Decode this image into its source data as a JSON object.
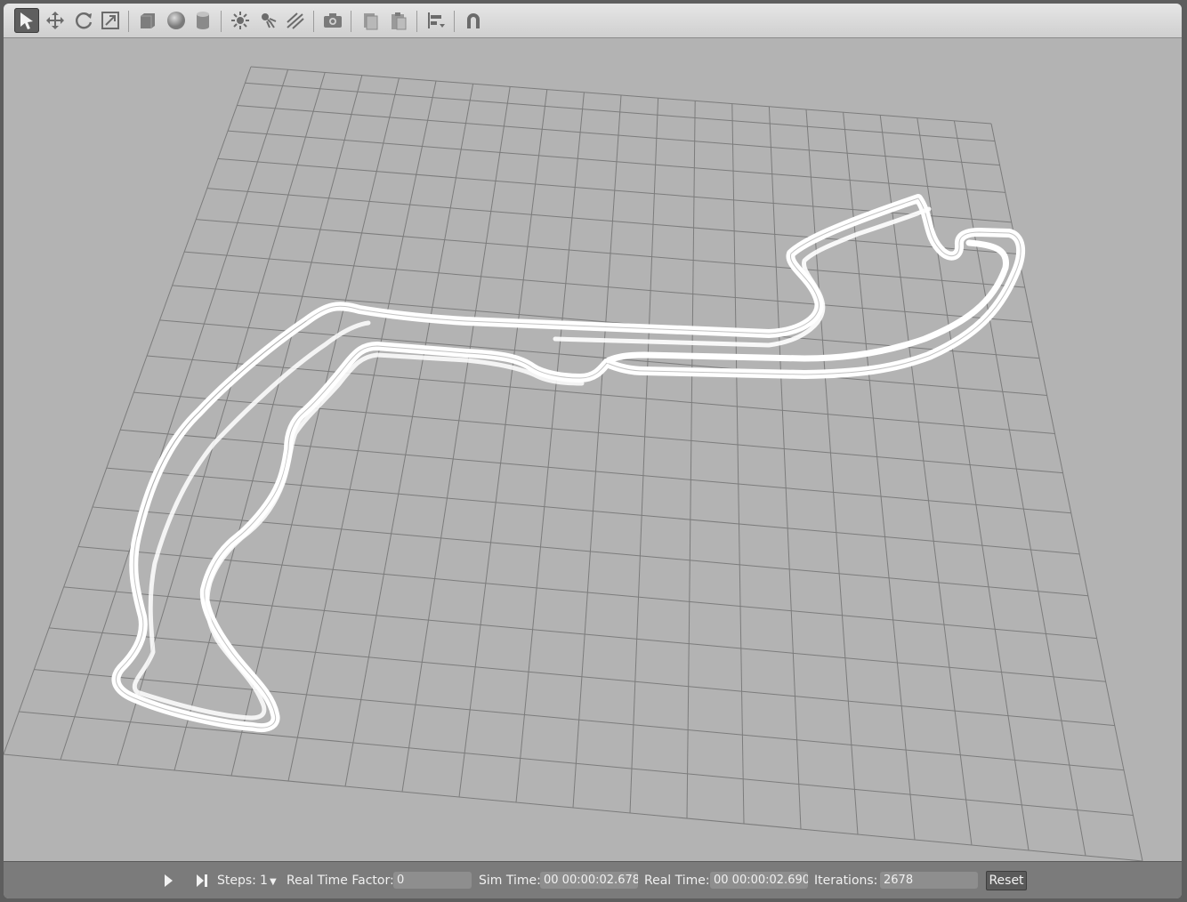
{
  "toolbar": {
    "icons": [
      "select-arrow-icon",
      "translate-icon",
      "rotate-icon",
      "scale-icon",
      "box-icon",
      "sphere-icon",
      "cylinder-icon",
      "point-light-icon",
      "spot-light-icon",
      "directional-light-icon",
      "screenshot-camera-icon",
      "copy-icon",
      "paste-icon",
      "align-icon",
      "snap-magnet-icon"
    ],
    "active": "select-arrow-icon"
  },
  "statusbar": {
    "steps_label": "Steps:",
    "steps_value": "1",
    "rtf_label": "Real Time Factor:",
    "rtf_value": "0",
    "sim_time_label": "Sim Time:",
    "sim_time_value": "00 00:00:02.678",
    "real_time_label": "Real Time:",
    "real_time_value": "00 00:00:02.690",
    "iterations_label": "Iterations:",
    "iterations_value": "2678",
    "reset_label": "Reset"
  },
  "colors": {
    "viewport_bg": "#b3b3b3",
    "grid_line": "#7c7c7c",
    "track": "#ffffff",
    "toolbar_bg": "#d9d9d9",
    "statusbar_bg": "#7b7b7b"
  }
}
